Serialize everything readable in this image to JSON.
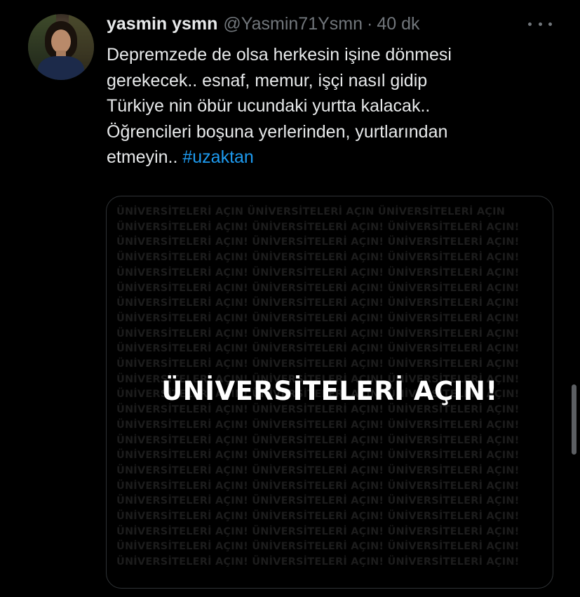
{
  "tweet": {
    "display_name": "yasmin ysmn",
    "handle": "@Yasmin71Ysmn",
    "separator": "·",
    "time": "40 dk",
    "text_lines": [
      "Depremzede de olsa herkesin işine dönmesi",
      "gerekecek.. esnaf, memur, işçi nasıl gidip",
      "Türkiye nin öbür ucundaki yurtta kalacak..",
      "Öğrencileri boşuna yerlerinden, yurtlarından",
      "etmeyin.. "
    ],
    "hashtag": "#uzaktan",
    "media": {
      "headline": "ÜNİVERSİTELERİ AÇIN!",
      "background_rows": [
        "ÜNİVERSİTELERİ AÇIN  ÜNİVERSİTELERİ AÇIN  ÜNİVERSİTELERİ AÇIN",
        "ÜNİVERSİTELERİ AÇIN! ÜNİVERSİTELERİ AÇIN! ÜNİVERSİTELERİ AÇIN!",
        "ÜNİVERSİTELERİ AÇIN! ÜNİVERSİTELERİ AÇIN! ÜNİVERSİTELERİ AÇIN!",
        "ÜNİVERSİTELERİ AÇIN! ÜNİVERSİTELERİ AÇIN! ÜNİVERSİTELERİ AÇIN!",
        "ÜNİVERSİTELERİ AÇIN! ÜNİVERSİTELERİ AÇIN! ÜNİVERSİTELERİ AÇIN!",
        "ÜNİVERSİTELERİ AÇIN! ÜNİVERSİTELERİ AÇIN! ÜNİVERSİTELERİ AÇIN!",
        "ÜNİVERSİTELERİ AÇIN! ÜNİVERSİTELERİ AÇIN! ÜNİVERSİTELERİ AÇIN!",
        "ÜNİVERSİTELERİ AÇIN! ÜNİVERSİTELERİ AÇIN! ÜNİVERSİTELERİ AÇIN!",
        "ÜNİVERSİTELERİ AÇIN! ÜNİVERSİTELERİ AÇIN! ÜNİVERSİTELERİ AÇIN!",
        "ÜNİVERSİTELERİ AÇIN! ÜNİVERSİTELERİ AÇIN! ÜNİVERSİTELERİ AÇIN!",
        "ÜNİVERSİTELERİ AÇIN! ÜNİVERSİTELERİ AÇIN! ÜNİVERSİTELERİ AÇIN!",
        "ÜNİVERSİTELERİ AÇIN! ÜNİVERSİTELERİ AÇIN! ÜNİVERSİTELERİ AÇIN!",
        "ÜNİVERSİTELERİ AÇIN! ÜNİVERSİTELERİ AÇIN! ÜNİVERSİTELERİ AÇIN!",
        "ÜNİVERSİTELERİ AÇIN! ÜNİVERSİTELERİ AÇIN! ÜNİVERSİTELERİ AÇIN!",
        "ÜNİVERSİTELERİ AÇIN! ÜNİVERSİTELERİ AÇIN! ÜNİVERSİTELERİ AÇIN!",
        "ÜNİVERSİTELERİ AÇIN! ÜNİVERSİTELERİ AÇIN! ÜNİVERSİTELERİ AÇIN!",
        "ÜNİVERSİTELERİ AÇIN! ÜNİVERSİTELERİ AÇIN! ÜNİVERSİTELERİ AÇIN!",
        "ÜNİVERSİTELERİ AÇIN! ÜNİVERSİTELERİ AÇIN! ÜNİVERSİTELERİ AÇIN!",
        "ÜNİVERSİTELERİ AÇIN! ÜNİVERSİTELERİ AÇIN! ÜNİVERSİTELERİ AÇIN!",
        "ÜNİVERSİTELERİ AÇIN! ÜNİVERSİTELERİ AÇIN! ÜNİVERSİTELERİ AÇIN!",
        "ÜNİVERSİTELERİ AÇIN! ÜNİVERSİTELERİ AÇIN! ÜNİVERSİTELERİ AÇIN!",
        "ÜNİVERSİTELERİ AÇIN! ÜNİVERSİTELERİ AÇIN! ÜNİVERSİTELERİ AÇIN!",
        "ÜNİVERSİTELERİ AÇIN! ÜNİVERSİTELERİ AÇIN! ÜNİVERSİTELERİ AÇIN!",
        "ÜNİVERSİTELERİ AÇIN! ÜNİVERSİTELERİ AÇIN! ÜNİVERSİTELERİ AÇIN!"
      ]
    }
  },
  "icons": {
    "more": "more-horizontal-icon",
    "avatar": "user-avatar"
  },
  "colors": {
    "background": "#000000",
    "text": "#e7e9ea",
    "muted": "#71767b",
    "link": "#1d9bf0",
    "border": "#2f3336"
  }
}
